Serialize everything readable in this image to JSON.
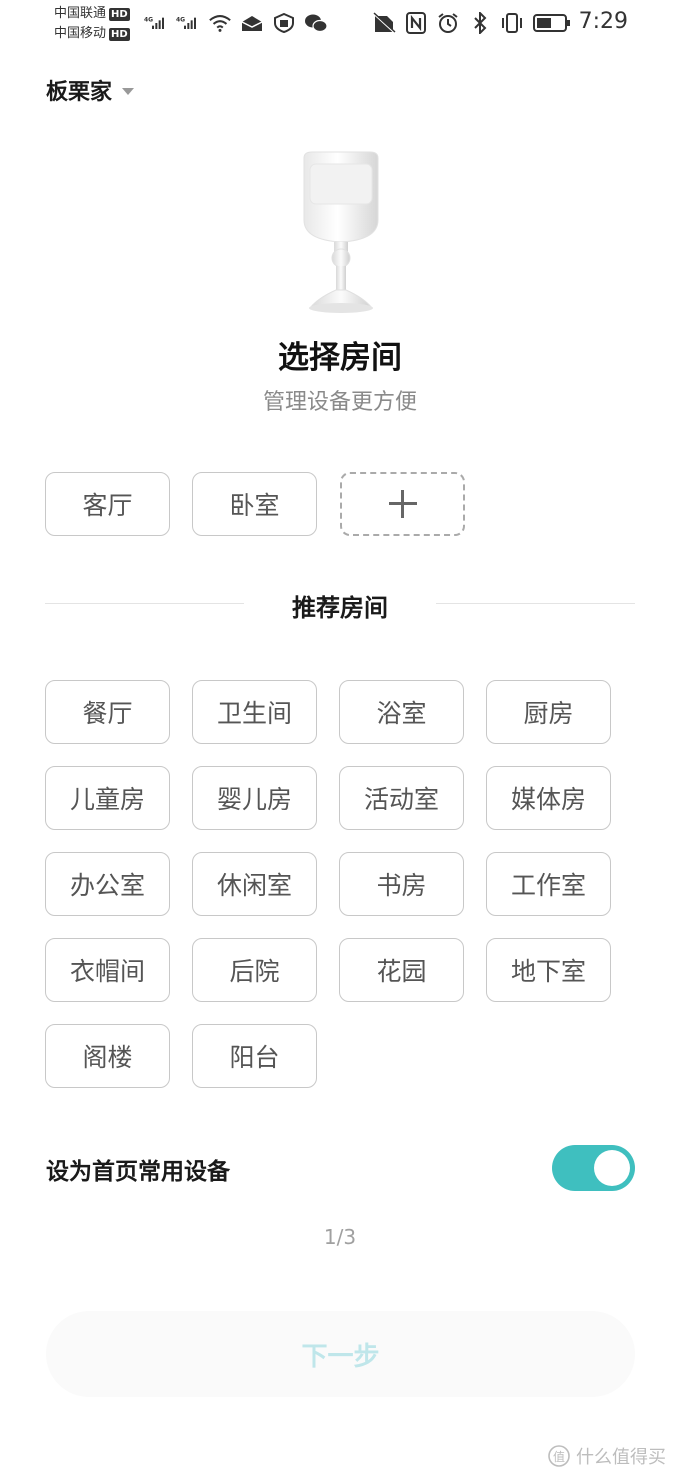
{
  "status_bar": {
    "carrier1": "中国联通",
    "carrier2": "中国移动",
    "hd_badge": "HD",
    "network": "4G",
    "time": "7:29",
    "left_icons": [
      "signal-icon",
      "signal-icon",
      "wifi-icon",
      "mail-icon",
      "shield-icon",
      "wechat-icon"
    ],
    "right_icons": [
      "no-sim-icon",
      "nfc-icon",
      "alarm-icon",
      "bluetooth-icon",
      "vibrate-icon",
      "battery-icon"
    ]
  },
  "header": {
    "home_name": "板栗家"
  },
  "main": {
    "title": "选择房间",
    "subtitle": "管理设备更方便",
    "my_rooms": [
      "客厅",
      "卧室"
    ],
    "recommended_title": "推荐房间",
    "recommended_rooms": [
      "餐厅",
      "卫生间",
      "浴室",
      "厨房",
      "儿童房",
      "婴儿房",
      "活动室",
      "媒体房",
      "办公室",
      "休闲室",
      "书房",
      "工作室",
      "衣帽间",
      "后院",
      "花园",
      "地下室",
      "阁楼",
      "阳台"
    ]
  },
  "settings": {
    "favorite_label": "设为首页常用设备",
    "favorite_on": true
  },
  "pager": {
    "indicator": "1/3"
  },
  "footer": {
    "next_label": "下一步"
  },
  "watermark": {
    "text": "什么值得买"
  },
  "colors": {
    "accent": "#3fbfbf",
    "button_text_disabled": "#bfe6ea"
  }
}
